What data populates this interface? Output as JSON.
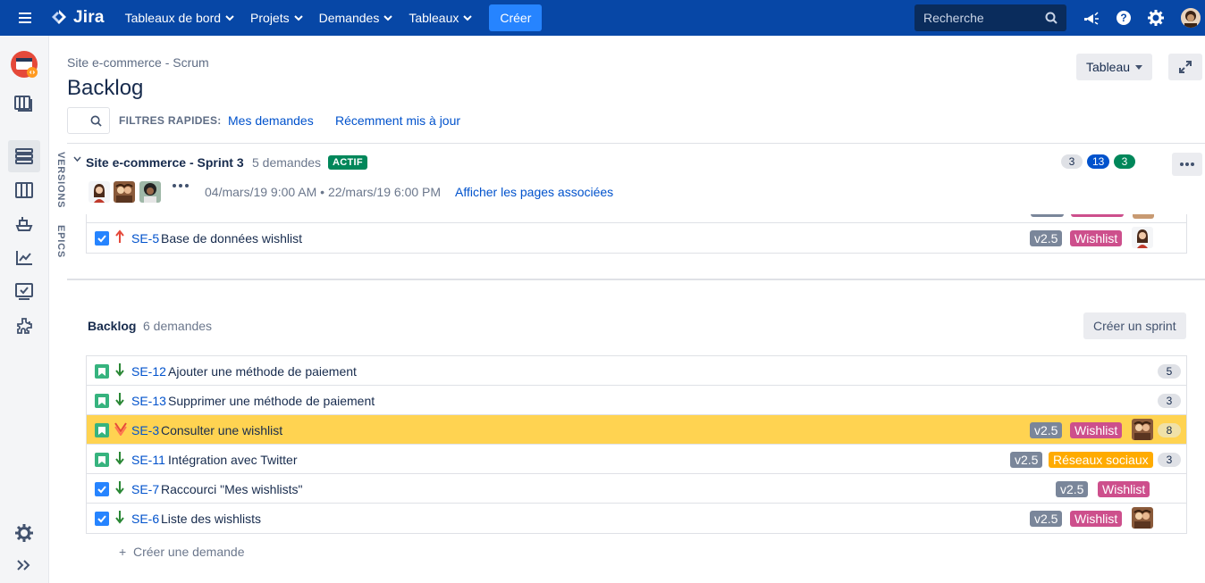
{
  "topnav": {
    "logo": "Jira",
    "items": [
      {
        "label": "Tableaux de bord"
      },
      {
        "label": "Projets"
      },
      {
        "label": "Demandes"
      },
      {
        "label": "Tableaux"
      }
    ],
    "create_label": "Créer",
    "search_placeholder": "Recherche",
    "bg_color": "#0747a6",
    "create_color": "#2684ff"
  },
  "sidebar": {
    "icons": [
      "project-avatar-icon",
      "boards-icon",
      "backlog-icon",
      "board-columns-icon",
      "releases-icon",
      "reports-icon",
      "issues-icon",
      "addons-icon",
      "settings-icon",
      "expand-icon"
    ]
  },
  "side_tabs": {
    "versions": "VERSIONS",
    "epics": "EPICS"
  },
  "header": {
    "breadcrumb": "Site e-commerce - Scrum",
    "title": "Backlog",
    "board_button": "Tableau",
    "quick_filters_label": "FILTRES RAPIDES:",
    "quick_filters": [
      "Mes demandes",
      "Récemment mis à jour"
    ]
  },
  "sprint": {
    "name": "Site e-commerce - Sprint 3",
    "count": "5 demandes",
    "status": "ACTIF",
    "points_todo": "3",
    "points_inprogress": "13",
    "points_done": "3",
    "dates": "04/mars/19 9:00 AM • 22/mars/19 6:00 PM",
    "pages_link": "Afficher les pages associées",
    "issues": [
      {
        "key": "SE-5",
        "summary": "Base de données wishlist",
        "version": "v2.5",
        "epic": "Wishlist",
        "type": "task",
        "priority": "high"
      }
    ]
  },
  "backlog": {
    "title": "Backlog",
    "count": "6 demandes",
    "create_sprint": "Créer un sprint",
    "create_issue": "Créer une demande",
    "issues": [
      {
        "key": "SE-12",
        "summary": "Ajouter une méthode de paiement",
        "estimate": "5",
        "type": "story",
        "priority": "low"
      },
      {
        "key": "SE-13",
        "summary": "Supprimer une méthode de paiement",
        "estimate": "3",
        "type": "story",
        "priority": "low"
      },
      {
        "key": "SE-3",
        "summary": "Consulter une wishlist",
        "version": "v2.5",
        "epic": "Wishlist",
        "estimate": "8",
        "type": "story",
        "priority": "highest",
        "selected": true
      },
      {
        "key": "SE-11",
        "summary": "Intégration avec Twitter",
        "version": "v2.5",
        "epic": "Réseaux sociaux",
        "estimate": "3",
        "type": "story",
        "priority": "low"
      },
      {
        "key": "SE-7",
        "summary": "Raccourci \"Mes wishlists\"",
        "version": "v2.5",
        "epic": "Wishlist",
        "type": "task",
        "priority": "low"
      },
      {
        "key": "SE-6",
        "summary": "Liste des wishlists",
        "version": "v2.5",
        "epic": "Wishlist",
        "type": "task",
        "priority": "low"
      }
    ]
  },
  "colors": {
    "link": "#0052cc",
    "selected_row": "#ffd351",
    "version_label": "#7a869a",
    "epic_wishlist": "#cd4f8c",
    "epic_social": "#ffab00",
    "status_active": "#00875a"
  }
}
